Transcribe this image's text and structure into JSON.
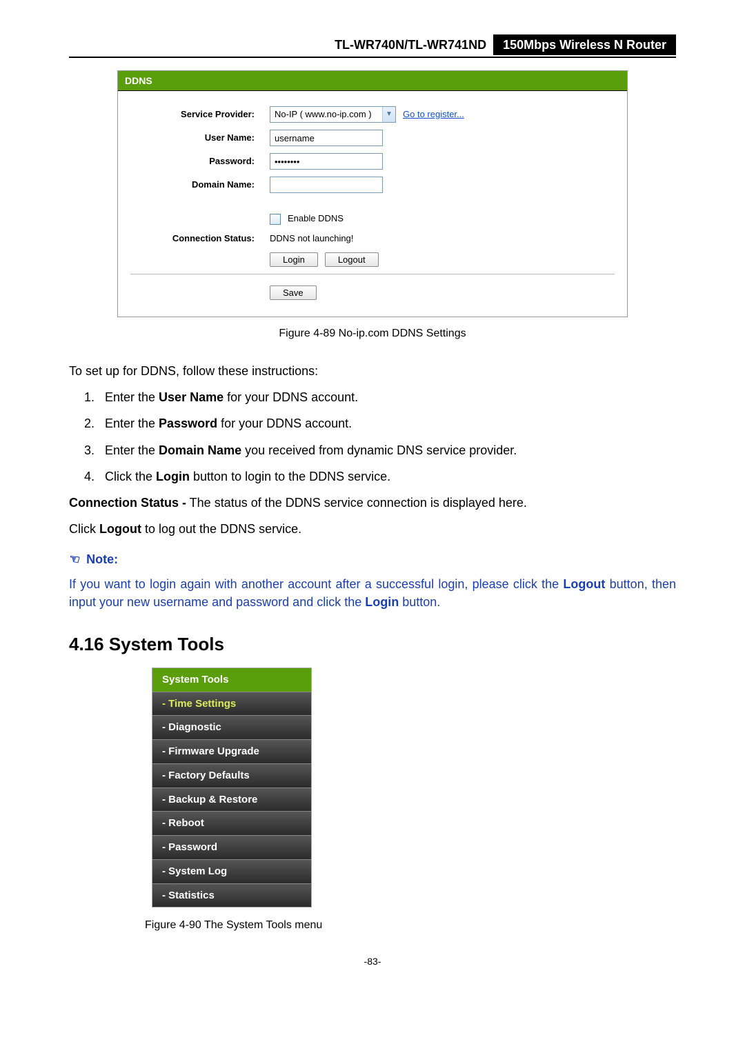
{
  "header": {
    "model": "TL-WR740N/TL-WR741ND",
    "product": "150Mbps Wireless N Router"
  },
  "ddns_panel": {
    "title": "DDNS",
    "labels": {
      "service_provider": "Service Provider:",
      "user_name": "User Name:",
      "password": "Password:",
      "domain_name": "Domain Name:",
      "connection_status": "Connection Status:"
    },
    "values": {
      "service_provider": "No-IP ( www.no-ip.com )",
      "register_link": "Go to register...",
      "user_name": "username",
      "password": "••••••••",
      "domain_name": "",
      "enable_ddns_label": "Enable DDNS",
      "connection_status": "DDNS not launching!"
    },
    "buttons": {
      "login": "Login",
      "logout": "Logout",
      "save": "Save"
    }
  },
  "figure1_caption": "Figure 4-89 No-ip.com DDNS Settings",
  "instructions_intro": "To set up for DDNS, follow these instructions:",
  "steps": {
    "s1a": "Enter the ",
    "s1b": "User Name",
    "s1c": " for your DDNS account.",
    "s2a": "Enter the ",
    "s2b": "Password",
    "s2c": " for your DDNS account.",
    "s3a": "Enter the ",
    "s3b": "Domain Name",
    "s3c": " you received from dynamic DNS service provider.",
    "s4a": "Click the ",
    "s4b": "Login",
    "s4c": " button to login to the DDNS service."
  },
  "conn_status": {
    "label": "Connection Status -",
    "text": " The status of the DDNS service connection is displayed here."
  },
  "logout_line": {
    "a": "Click ",
    "b": "Logout",
    "c": " to log out the DDNS service."
  },
  "note": {
    "label": "Note:",
    "t1": " If you want to login again with another account after a successful login, please click the ",
    "b1": "Logout",
    "t2": " button, then input your new username and password and click the ",
    "b2": "Login",
    "t3": " button."
  },
  "section_title": "4.16  System Tools",
  "sysmenu": {
    "header": "System Tools",
    "items": [
      {
        "label": "- Time Settings",
        "active": true
      },
      {
        "label": "- Diagnostic"
      },
      {
        "label": "- Firmware Upgrade"
      },
      {
        "label": "- Factory Defaults"
      },
      {
        "label": "- Backup & Restore"
      },
      {
        "label": "- Reboot"
      },
      {
        "label": "- Password"
      },
      {
        "label": "- System Log"
      },
      {
        "label": "- Statistics"
      }
    ]
  },
  "figure2_caption": "Figure 4-90    The System Tools menu",
  "page_number": "-83-"
}
